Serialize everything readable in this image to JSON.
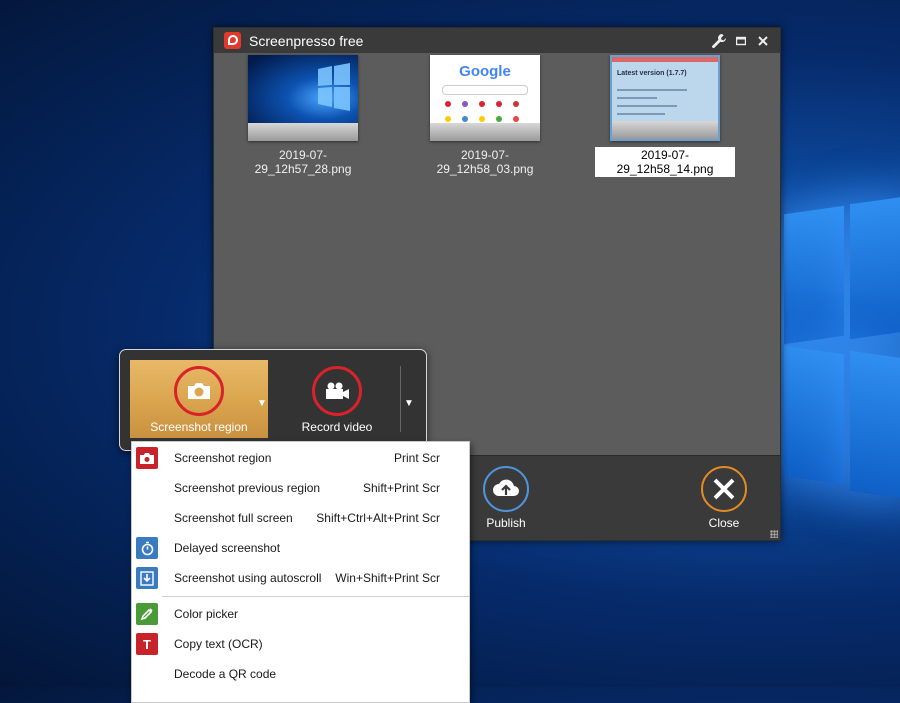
{
  "window": {
    "title": "Screenpresso free",
    "controls": {
      "settings": "wrench-icon",
      "maximize": "restore-icon",
      "close": "close-icon"
    }
  },
  "gallery": {
    "items": [
      {
        "name": "2019-07-29_12h57_28.png",
        "selected": false,
        "preview": "windows-desktop"
      },
      {
        "name": "2019-07-29_12h58_03.png",
        "selected": false,
        "preview": "google-homepage"
      },
      {
        "name": "2019-07-29_12h58_14.png",
        "selected": true,
        "preview": "version-page"
      }
    ],
    "google_preview": {
      "logo": "Google"
    },
    "version_preview": {
      "heading": "Latest version (1.7.7)"
    }
  },
  "actions": {
    "publish_label": "Publish",
    "close_label": "Close"
  },
  "capture": {
    "screenshot_label": "Screenshot region",
    "record_label": "Record video"
  },
  "menu": {
    "items": [
      {
        "label": "Screenshot region",
        "shortcut": "Print Scr",
        "icon": "camera-icon",
        "icon_color": "#c8232a"
      },
      {
        "label": "Screenshot previous region",
        "shortcut": "Shift+Print Scr"
      },
      {
        "label": "Screenshot full screen",
        "shortcut": "Shift+Ctrl+Alt+Print Scr"
      },
      {
        "label": "Delayed screenshot",
        "shortcut": "",
        "icon": "timer-icon",
        "icon_color": "#3a7bc0"
      },
      {
        "label": "Screenshot using autoscroll",
        "shortcut": "Win+Shift+Print Scr",
        "icon": "autoscroll-icon",
        "icon_color": "#3a7bc0"
      },
      {
        "label": "Color picker",
        "shortcut": "",
        "icon": "color-picker-icon",
        "icon_color": "#4a9a3a"
      },
      {
        "label": "Copy text (OCR)",
        "shortcut": "",
        "icon": "ocr-text-icon",
        "icon_color": "#c8232a",
        "icon_text": "T"
      },
      {
        "label": "Decode a QR code",
        "shortcut": ""
      }
    ]
  },
  "colors": {
    "accent_orange": "#e48a22",
    "publish_blue": "#4f95db",
    "record_red": "#d8232a",
    "active_gold": "#dba650"
  }
}
